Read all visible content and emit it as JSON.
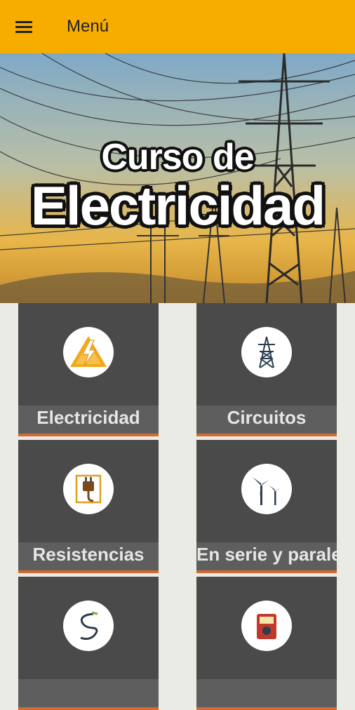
{
  "appbar": {
    "title": "Menú",
    "menu_icon": "hamburger-menu-icon",
    "color": "#f7ac00"
  },
  "hero": {
    "line1": "Curso de",
    "line2": "Electricidad"
  },
  "tiles": [
    {
      "label": "Electricidad",
      "icon": "lightning-icon"
    },
    {
      "label": "Circuitos",
      "icon": "transmission-tower-icon"
    },
    {
      "label": "Resistencias",
      "icon": "plug-icon"
    },
    {
      "label": "En serie y paralelo",
      "icon": "wind-turbine-icon"
    },
    {
      "label": "",
      "icon": "coil-icon"
    },
    {
      "label": "",
      "icon": "multimeter-icon"
    }
  ],
  "colors": {
    "tile_bg": "#4a4a4a",
    "tile_label_bg": "#5e5e5e",
    "accent_stripe": "#d46a2f"
  }
}
